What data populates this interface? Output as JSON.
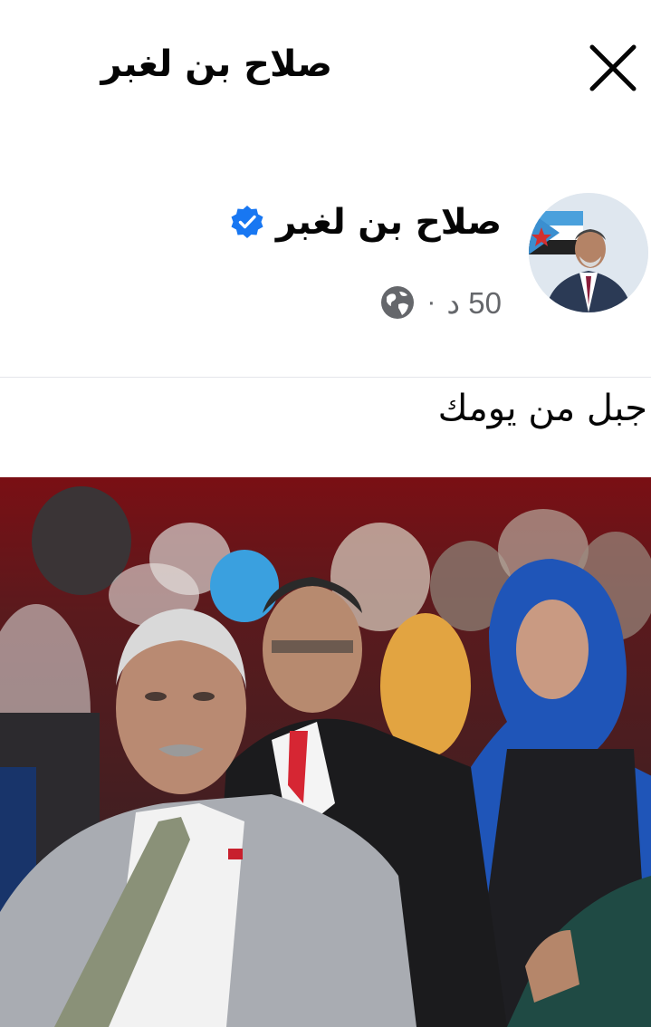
{
  "header": {
    "title": "صلاح بن لغبر",
    "close_icon": "close-icon"
  },
  "post": {
    "author_name": "صلاح بن لغبر",
    "verified_icon": "verified-badge-icon",
    "time": "50 د",
    "separator": "·",
    "privacy_icon": "globe-icon",
    "text": "جبل من يومك",
    "image_desc_icon": "photo"
  },
  "colors": {
    "verified_blue": "#1877f2",
    "meta_gray": "#65676b",
    "divider": "#e4e6eb",
    "text": "#050505"
  }
}
